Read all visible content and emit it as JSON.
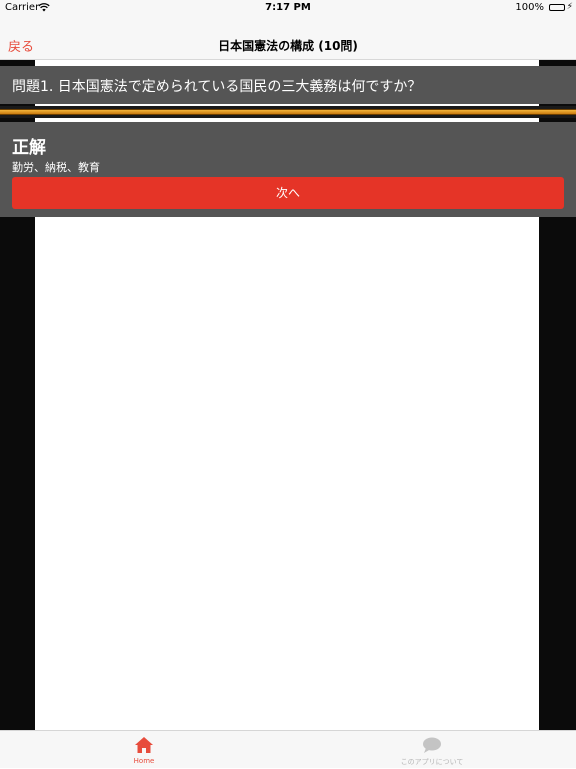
{
  "status_bar": {
    "carrier": "Carrier",
    "time": "7:17 PM",
    "battery": "100%"
  },
  "nav": {
    "back_label": "戻る",
    "title": "日本国憲法の構成 (10問)"
  },
  "quiz": {
    "question": "問題1. 日本国憲法で定められている国民の三大義務は何ですか？",
    "progress": 1.0
  },
  "answer": {
    "title": "正解",
    "text": "勤労、納税、教育",
    "next_label": "次へ"
  },
  "tabs": [
    {
      "label": "Home",
      "icon": "home-icon",
      "active": true
    },
    {
      "label": "このアプリについて",
      "icon": "chat-bubble-icon",
      "active": false
    }
  ],
  "colors": {
    "accent": "#e74c3c",
    "button": "#e53427",
    "panel": "#555555",
    "progress": "#e8a127"
  }
}
